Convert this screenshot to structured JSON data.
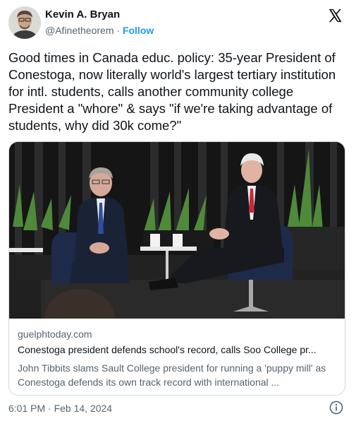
{
  "author": {
    "name": "Kevin A. Bryan",
    "handle": "@Afinetheorem",
    "separator": "·",
    "follow_label": "Follow"
  },
  "icons": {
    "x_logo": "x-logo-icon",
    "info": "info-icon"
  },
  "tweet": {
    "text": "Good times in Canada educ. policy: 35-year President of Conestoga, now literally world's largest tertiary institution for intl. students, calls another community college President a \"whore\" & says \"if we're taking advantage of students, why did 30k come?\""
  },
  "link_card": {
    "domain": "guelphtoday.com",
    "headline": "Conestoga president defends school's record, calls Soo College pr...",
    "description": "John Tibbits slams Sault College president for running a 'puppy mill' as Conestoga defends its own track record with international ..."
  },
  "footer": {
    "timestamp": "6:01 PM · Feb 14, 2024"
  },
  "colors": {
    "accent": "#1d9bf0",
    "secondary_text": "#536471",
    "border": "#cfd9de"
  }
}
